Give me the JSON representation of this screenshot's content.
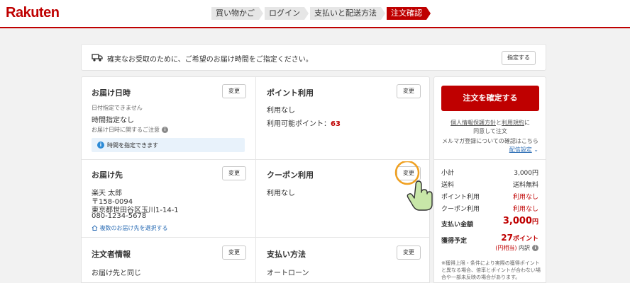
{
  "header": {
    "logo": "Rakuten",
    "steps": [
      "買い物かご",
      "ログイン",
      "支払いと配送方法",
      "注文確認"
    ],
    "active_step": 3,
    "accent_color": "#bf0000"
  },
  "notice": {
    "icon": "delivery-truck-clock-icon",
    "text": "確実なお受取のために、ご希望のお届け時間をご指定ください。",
    "button": "指定する"
  },
  "sections": {
    "delivery_datetime": {
      "title": "お届け日時",
      "change": "変更",
      "no_date": "日付指定できません",
      "time": "時間指定なし",
      "caution": "お届け日時に関するご注意",
      "info": "時間を指定できます"
    },
    "points": {
      "title": "ポイント利用",
      "change": "変更",
      "usage": "利用なし",
      "available_label": "利用可能ポイント：",
      "available_value": "63"
    },
    "shipping_address": {
      "title": "お届け先",
      "change": "変更",
      "name": "楽天 太郎",
      "postal": "〒158-0094",
      "address": "東京都世田谷区玉川1-14-1",
      "phone": "080-1234-5678",
      "multi_link": "複数のお届け先を選択する"
    },
    "coupon": {
      "title": "クーポン利用",
      "change": "変更",
      "usage": "利用なし"
    },
    "orderer": {
      "title": "注文者情報",
      "change": "変更",
      "value": "お届け先と同じ"
    },
    "payment": {
      "title": "支払い方法",
      "change": "変更",
      "value": "オートローン"
    }
  },
  "summary": {
    "confirm_button": "注文を確定する",
    "privacy_link": "個人情報保護方針",
    "and": "と",
    "terms_link": "利用規約",
    "terms_suffix": "に",
    "agree": "同意して注文",
    "mail_note": "メルマガ登録についての確認はこちら",
    "mail_settings": "配信設定",
    "rows": [
      {
        "label": "小計",
        "value": "3,000円",
        "highlight": false
      },
      {
        "label": "送料",
        "value": "送料無料",
        "highlight": false
      },
      {
        "label": "ポイント利用",
        "value": "利用なし",
        "highlight": true
      },
      {
        "label": "クーポン利用",
        "value": "利用なし",
        "highlight": true
      }
    ],
    "total_label": "支払い金額",
    "total_value": "3,000",
    "total_unit": "円",
    "earn_label": "獲得予定",
    "earn_value": "27",
    "earn_unit": "ポイント",
    "earn_equiv": "(円相当)",
    "earn_breakdown": "内訳",
    "fineprint": "※獲得上限・条件により実際の獲得ポイントと異なる場合、倍率とポイントが合わない場合や一部未反映の場合があります。"
  }
}
